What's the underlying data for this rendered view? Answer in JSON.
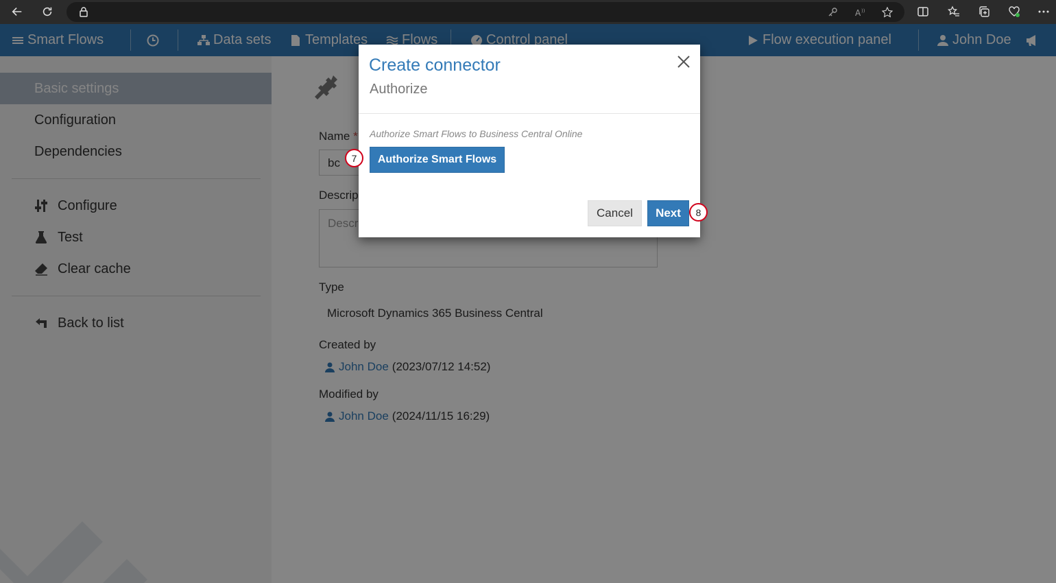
{
  "browser": {
    "icons": [
      "back-icon",
      "refresh-icon",
      "lock-icon",
      "key-icon",
      "read-aloud-icon",
      "favorite-star-icon",
      "split-screen-icon",
      "favorites-icon",
      "collections-icon",
      "health-icon",
      "more-icon"
    ]
  },
  "navbar": {
    "brand": "Smart Flows",
    "datasets": "Data sets",
    "templates": "Templates",
    "flows": "Flows",
    "control_panel": "Control panel",
    "flow_execution": "Flow execution panel",
    "user": "John Doe",
    "color": "#337ab7"
  },
  "sidebar": {
    "items": [
      {
        "label": "Basic settings"
      },
      {
        "label": "Configuration"
      },
      {
        "label": "Dependencies"
      }
    ],
    "actions": [
      {
        "label": "Configure",
        "icon": "sliders-icon"
      },
      {
        "label": "Test",
        "icon": "flask-icon"
      },
      {
        "label": "Clear cache",
        "icon": "eraser-icon"
      }
    ],
    "back": {
      "label": "Back to list",
      "icon": "back-arrow-icon"
    }
  },
  "form": {
    "name_label": "Name",
    "name_required": "*",
    "name_value": "bc",
    "description_label": "Descrip",
    "description_placeholder": "Descr",
    "type_label": "Type",
    "type_value": "Microsoft Dynamics 365 Business Central",
    "created_label": "Created by",
    "created_user": "John Doe",
    "created_date": "(2023/07/12 14:52)",
    "modified_label": "Modified by",
    "modified_user": "John Doe",
    "modified_date": "(2024/11/15 16:29)"
  },
  "modal": {
    "title": "Create connector",
    "subtitle": "Authorize",
    "hint": "Authorize Smart Flows to Business Central Online",
    "authorize_button": "Authorize Smart Flows",
    "cancel_button": "Cancel",
    "next_button": "Next"
  },
  "steps": {
    "authorize": "7",
    "next": "8"
  }
}
